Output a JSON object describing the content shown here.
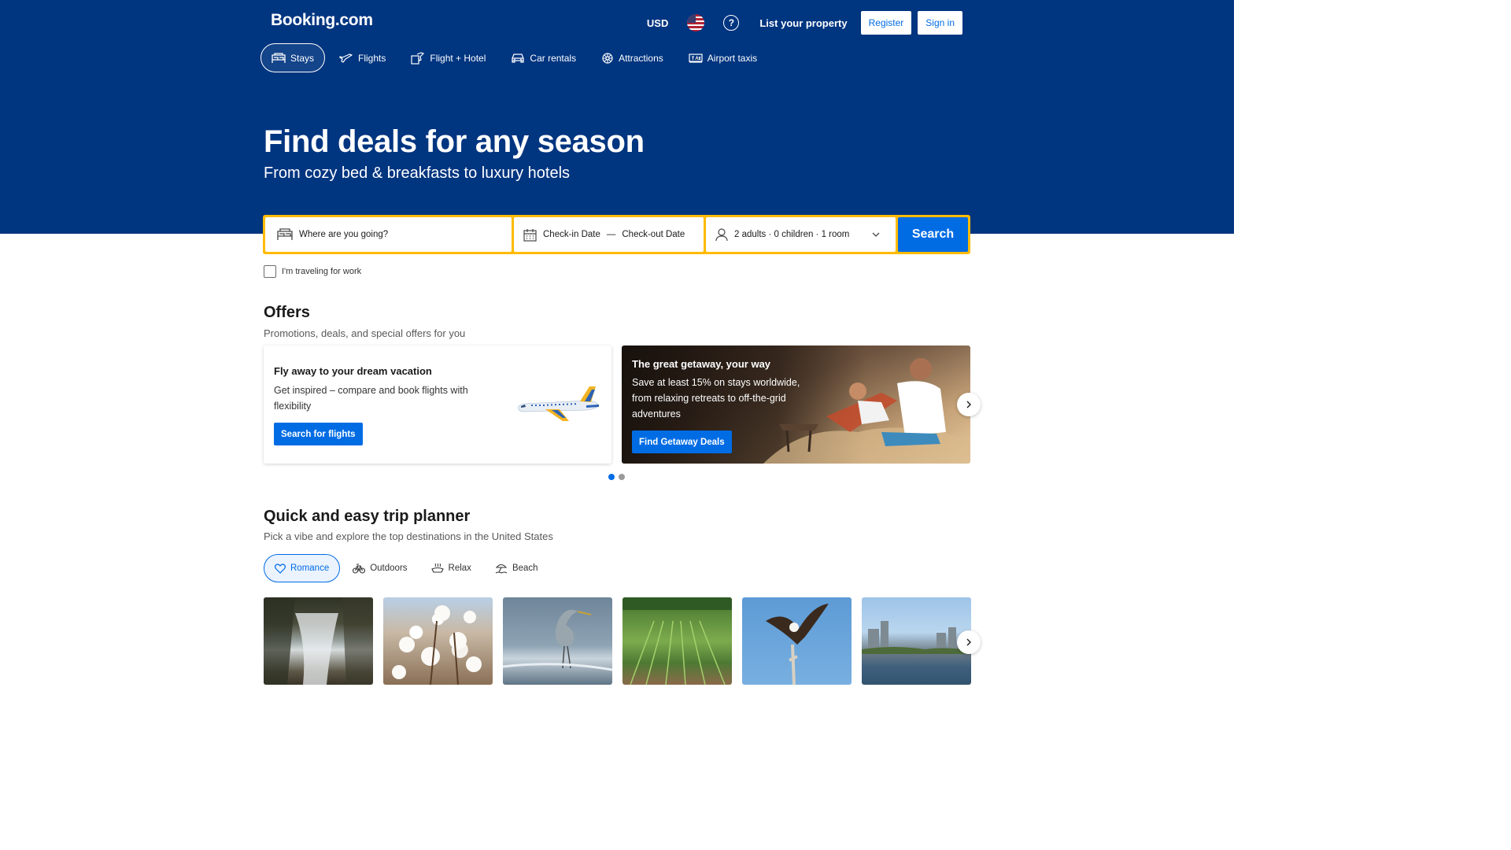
{
  "header": {
    "logo": "Booking.com",
    "currency": "USD",
    "list_property": "List your property",
    "register": "Register",
    "sign_in": "Sign in"
  },
  "nav": [
    {
      "label": "Stays",
      "icon": "bed-icon",
      "active": true
    },
    {
      "label": "Flights",
      "icon": "plane-icon"
    },
    {
      "label": "Flight + Hotel",
      "icon": "flight-hotel-icon"
    },
    {
      "label": "Car rentals",
      "icon": "car-icon"
    },
    {
      "label": "Attractions",
      "icon": "attractions-icon"
    },
    {
      "label": "Airport taxis",
      "icon": "taxi-icon"
    }
  ],
  "hero": {
    "title": "Find deals for any season",
    "subtitle": "From cozy bed & breakfasts to luxury hotels"
  },
  "search": {
    "destination_placeholder": "Where are you going?",
    "check_in": "Check-in Date",
    "dash": "—",
    "check_out": "Check-out Date",
    "guests": "2 adults · 0 children · 1 room",
    "button": "Search",
    "work_label": "I'm traveling for work"
  },
  "offers": {
    "title": "Offers",
    "subtitle": "Promotions, deals, and special offers for you",
    "cards": [
      {
        "title": "Fly away to your dream vacation",
        "text": "Get inspired – compare and book flights with flexibility",
        "button": "Search for flights"
      },
      {
        "title": "The great getaway, your way",
        "text": "Save at least 15% on stays worldwide, from relaxing retreats to off-the-grid adventures",
        "button": "Find Getaway Deals"
      }
    ],
    "carousel_page": 1,
    "carousel_pages": 2
  },
  "planner": {
    "title": "Quick and easy trip planner",
    "subtitle": "Pick a vibe and explore the top destinations in the United States",
    "vibes": [
      {
        "label": "Romance",
        "icon": "heart-icon",
        "active": true
      },
      {
        "label": "Outdoors",
        "icon": "bicycle-icon"
      },
      {
        "label": "Relax",
        "icon": "relax-icon"
      },
      {
        "label": "Beach",
        "icon": "beach-icon"
      }
    ],
    "photos": [
      "waterfall",
      "cotton-field",
      "heron",
      "corn-field",
      "eagle",
      "city-lake"
    ]
  },
  "colors": {
    "brand_blue": "#003580",
    "action_blue": "#006ce4",
    "search_border": "#febb02"
  }
}
